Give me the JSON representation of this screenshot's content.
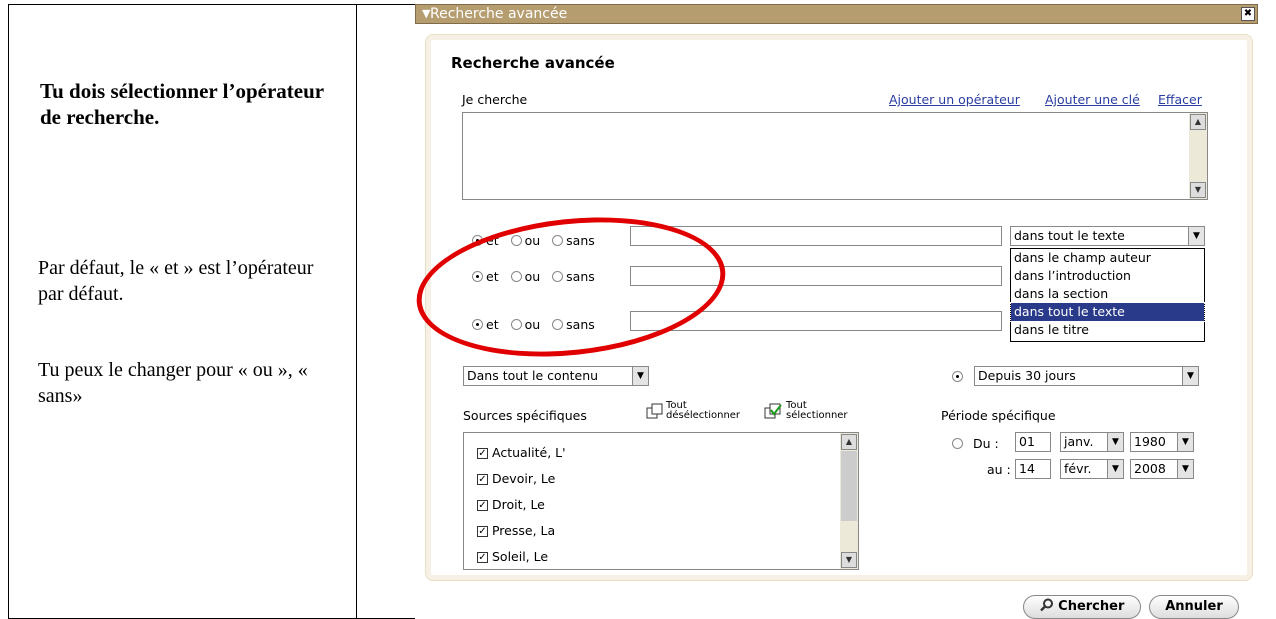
{
  "instructions": {
    "heading": "Tu dois sélectionner l’opérateur de recherche.",
    "para1": "Par défaut, le « et » est l’opérateur par défaut.",
    "para2": "Tu peux le changer pour « ou », « sans»"
  },
  "dialog": {
    "window_title": "Recherche avancée",
    "panel_title": "Recherche avancée",
    "search_label": "Je cherche",
    "links": [
      "Ajouter un opérateur",
      "Ajouter une clé",
      "Effacer"
    ],
    "operator_labels": [
      "et",
      "ou",
      "sans"
    ],
    "operator_rows": [
      {
        "selected": "et",
        "value": ""
      },
      {
        "selected": "et",
        "value": ""
      },
      {
        "selected": "et",
        "value": ""
      }
    ],
    "field_select_value": "dans tout le texte",
    "field_options": [
      "dans le champ auteur",
      "dans l’introduction",
      "dans la section",
      "dans tout le texte",
      "dans le titre"
    ],
    "field_selected_index": 3,
    "content_select": "Dans tout le contenu",
    "period_select": "Depuis 30 jours",
    "sources_label": "Sources spécifiques",
    "deselect_all": {
      "line1": "Tout",
      "line2": "désélectionner"
    },
    "select_all": {
      "line1": "Tout",
      "line2": "sélectionner"
    },
    "sources": [
      "Actualité, L'",
      "Devoir, Le",
      "Droit, Le",
      "Presse, La",
      "Soleil, Le"
    ],
    "period_label": "Période spécifique",
    "from_label": "Du :",
    "to_label": "au :",
    "from": {
      "day": "01",
      "month": "janv.",
      "year": "1980"
    },
    "to": {
      "day": "14",
      "month": "févr.",
      "year": "2008"
    },
    "search_button": "Chercher",
    "cancel_button": "Annuler"
  },
  "colors": {
    "titlebar": "#b59d70",
    "highlight": "#2a3a8a",
    "annotation_oval": "#e10000",
    "link": "#2a3da0"
  }
}
